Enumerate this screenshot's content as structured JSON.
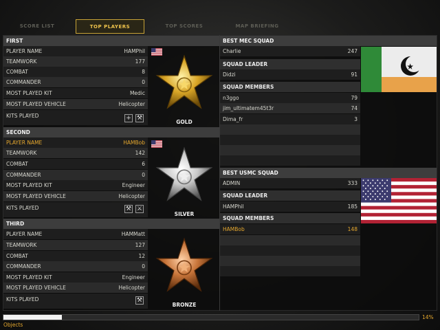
{
  "tabs": [
    {
      "label": "SCORE LIST"
    },
    {
      "label": "TOP PLAYERS",
      "active": true
    },
    {
      "label": "TOP SCORES"
    },
    {
      "label": "MAP BRIEFING"
    }
  ],
  "labels": {
    "player_name": "PLAYER NAME",
    "teamwork": "TEAMWORK",
    "combat": "COMBAT",
    "commander": "COMMANDER",
    "kit": "MOST PLAYED KIT",
    "vehicle": "MOST PLAYED VEHICLE",
    "kits_played": "KITS PLAYED"
  },
  "ranks": [
    {
      "heading": "FIRST",
      "medal": "GOLD",
      "player": "HAMPhil",
      "teamwork": "177",
      "combat": "8",
      "commander": "0",
      "kit": "Medic",
      "vehicle": "Helicopter",
      "flag": "usa",
      "kits": [
        "medic-kit-icon",
        "engineer-kit-icon"
      ]
    },
    {
      "heading": "SECOND",
      "medal": "SILVER",
      "player": "HAMBob",
      "teamwork": "142",
      "combat": "6",
      "commander": "0",
      "kit": "Engineer",
      "vehicle": "Helicopter",
      "flag": "usa",
      "highlight": true,
      "kits": [
        "engineer-kit-icon",
        "support-kit-icon"
      ]
    },
    {
      "heading": "THIRD",
      "medal": "BRONZE",
      "player": "HAMMatt",
      "teamwork": "127",
      "combat": "12",
      "commander": "0",
      "kit": "Engineer",
      "vehicle": "Helicopter",
      "kits": [
        "engineer-kit-icon"
      ]
    }
  ],
  "mec": {
    "heading": "BEST MEC SQUAD",
    "squad_name": "Charlie",
    "squad_score": "247",
    "leader_label": "SQUAD LEADER",
    "leader": {
      "name": "Didzi",
      "score": "91"
    },
    "members_label": "SQUAD MEMBERS",
    "members": [
      {
        "name": "n3ggo",
        "score": "79"
      },
      {
        "name": "jim_ultimatem45t3r",
        "score": "74"
      },
      {
        "name": "Dima_fr",
        "score": "3"
      }
    ]
  },
  "usmc": {
    "heading": "BEST USMC SQUAD",
    "squad_name": "ADMIN",
    "squad_score": "333",
    "leader_label": "SQUAD LEADER",
    "leader": {
      "name": "HAMPhil",
      "score": "185"
    },
    "members_label": "SQUAD MEMBERS",
    "members": [
      {
        "name": "HAMBob",
        "score": "148",
        "highlight": true
      }
    ]
  },
  "loading": {
    "percent_text": "14%",
    "progress": 0.14,
    "status": "Objects"
  },
  "colors": {
    "accent": "#e6a82e",
    "tab_border": "#c9a437",
    "gold": "#d9a627",
    "silver": "#c9c9c9",
    "bronze": "#c8753a"
  }
}
